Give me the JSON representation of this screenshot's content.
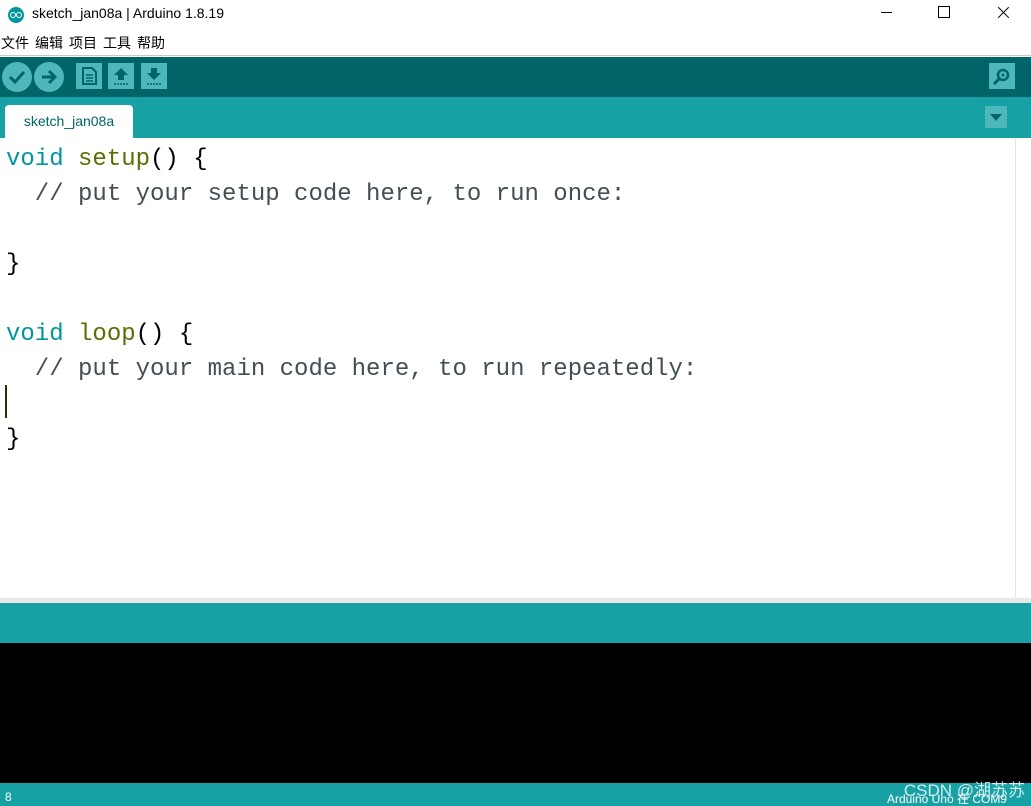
{
  "window": {
    "title": "sketch_jan08a | Arduino 1.8.19"
  },
  "menu": [
    "文件",
    "编辑",
    "项目",
    "工具",
    "帮助"
  ],
  "toolbar": {
    "verify_icon": "check-icon",
    "upload_icon": "arrow-right-icon",
    "new_icon": "document-icon",
    "open_icon": "arrow-up-icon",
    "save_icon": "arrow-down-icon",
    "serial_monitor_icon": "magnifier-icon"
  },
  "tabs": [
    {
      "label": "sketch_jan08a",
      "active": true
    }
  ],
  "editor": {
    "lines": [
      [
        {
          "t": "void",
          "c": "kw"
        },
        {
          "t": " ",
          "c": ""
        },
        {
          "t": "setup",
          "c": "fn"
        },
        {
          "t": "() {",
          "c": ""
        }
      ],
      [
        {
          "t": "  // put your setup code here, to run once:",
          "c": "cm"
        }
      ],
      [
        {
          "t": "",
          "c": ""
        }
      ],
      [
        {
          "t": "}",
          "c": ""
        }
      ],
      [
        {
          "t": "",
          "c": ""
        }
      ],
      [
        {
          "t": "void",
          "c": "kw"
        },
        {
          "t": " ",
          "c": ""
        },
        {
          "t": "loop",
          "c": "fn"
        },
        {
          "t": "() {",
          "c": ""
        }
      ],
      [
        {
          "t": "  // put your main code here, to run repeatedly:",
          "c": "cm"
        }
      ],
      [
        {
          "t": "",
          "c": ""
        }
      ],
      [
        {
          "t": "}",
          "c": ""
        }
      ]
    ]
  },
  "status": {
    "line_number": "8",
    "board": "Arduino Uno 在 COM9"
  },
  "watermark": "CSDN @湖苏苏",
  "colors": {
    "toolbar": "#006468",
    "accent": "#17a1a5",
    "button": "#4db7bb",
    "keyword": "#00979c",
    "function": "#5e6d03"
  }
}
